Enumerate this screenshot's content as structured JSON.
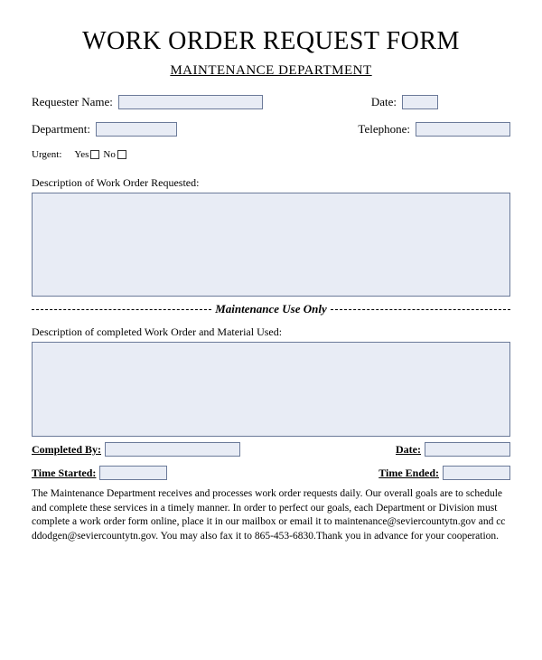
{
  "title": "WORK ORDER REQUEST FORM",
  "subtitle": "MAINTENANCE DEPARTMENT",
  "fields": {
    "requester_name": {
      "label": "Requester Name:"
    },
    "date": {
      "label": "Date:"
    },
    "department": {
      "label": "Department:"
    },
    "telephone": {
      "label": "Telephone:"
    },
    "urgent": {
      "label": "Urgent:",
      "yes": "Yes",
      "no": "No"
    },
    "description_requested": {
      "label": "Description of Work Order Requested:"
    },
    "description_completed": {
      "label": "Description of completed Work Order and Material Used:"
    },
    "completed_by": {
      "label": "Completed By:"
    },
    "date_completed": {
      "label": "Date:"
    },
    "time_started": {
      "label": "Time Started:"
    },
    "time_ended": {
      "label": "Time Ended:"
    }
  },
  "divider": "Maintenance Use Only",
  "footer": " The Maintenance Department receives and processes work order requests daily. Our overall goals are to schedule and complete these services in a timely manner.  In order to perfect our goals, each Department or Division must complete a work order form online, place it in our mailbox or email it to maintenance@seviercountytn.gov and cc ddodgen@seviercountytn.gov. You may also fax it to 865-453-6830.Thank you in advance for your cooperation."
}
